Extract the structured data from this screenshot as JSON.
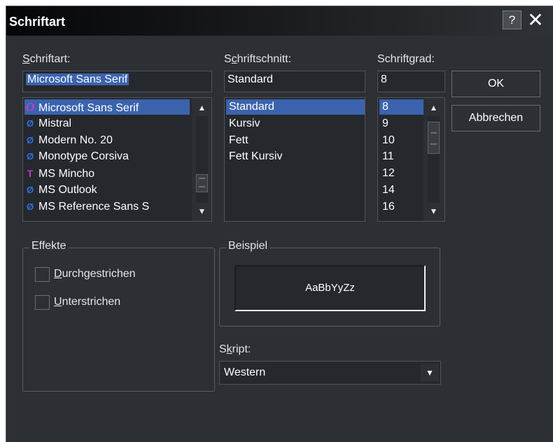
{
  "window": {
    "title": "Schriftart",
    "help_label": "?",
    "close_label": "✕"
  },
  "font": {
    "label_prefix": "",
    "label_mnemonic": "S",
    "label_rest": "chriftart:",
    "value": "Microsoft Sans Serif",
    "items": [
      {
        "name": "Microsoft Sans Serif",
        "icon": "o-icon",
        "icon_glyph": "O",
        "selected": true
      },
      {
        "name": "Mistral",
        "icon": "opentype-icon",
        "icon_glyph": "Ø",
        "selected": false
      },
      {
        "name": "Modern No. 20",
        "icon": "opentype-icon",
        "icon_glyph": "Ø",
        "selected": false
      },
      {
        "name": "Monotype Corsiva",
        "icon": "opentype-icon",
        "icon_glyph": "Ø",
        "selected": false
      },
      {
        "name": "MS Mincho",
        "icon": "truetype-icon",
        "icon_glyph": "T",
        "selected": false
      },
      {
        "name": "MS Outlook",
        "icon": "opentype-icon",
        "icon_glyph": "Ø",
        "selected": false
      },
      {
        "name": "MS Reference Sans S",
        "icon": "opentype-icon",
        "icon_glyph": "Ø",
        "selected": false
      }
    ],
    "scroll_fraction": 0.85
  },
  "style": {
    "label_prefix": "S",
    "label_mnemonic": "c",
    "label_rest": "hriftschnitt:",
    "value": "Standard",
    "items": [
      {
        "name": "Standard",
        "selected": true
      },
      {
        "name": "Kursiv",
        "selected": false
      },
      {
        "name": "Fett",
        "selected": false
      },
      {
        "name": "Fett Kursiv",
        "selected": false
      }
    ]
  },
  "size": {
    "label_prefix": "Schrift",
    "label_mnemonic": "g",
    "label_rest": "rad:",
    "value": "8",
    "items": [
      {
        "name": "8",
        "selected": true
      },
      {
        "name": "9",
        "selected": false
      },
      {
        "name": "10",
        "selected": false
      },
      {
        "name": "11",
        "selected": false
      },
      {
        "name": "12",
        "selected": false
      },
      {
        "name": "14",
        "selected": false
      },
      {
        "name": "16",
        "selected": false
      }
    ],
    "scroll_fraction": 0.1
  },
  "buttons": {
    "ok_label": "OK",
    "cancel_label": "Abbrechen"
  },
  "effects": {
    "title": "Effekte",
    "strikeout_mnemonic": "D",
    "strikeout_rest": "urchgestrichen",
    "strikeout_checked": false,
    "underline_mnemonic": "U",
    "underline_rest": "nterstrichen",
    "underline_checked": false
  },
  "sample": {
    "title": "Beispiel",
    "text": "AaBbYyZz"
  },
  "script": {
    "label_prefix": "S",
    "label_mnemonic": "k",
    "label_rest": "ript:",
    "value": "Western"
  },
  "colors": {
    "dialog_bg": "#2c2f33",
    "selection": "#3b63ad",
    "field_bg": "#25282c",
    "text": "#ffffff"
  }
}
